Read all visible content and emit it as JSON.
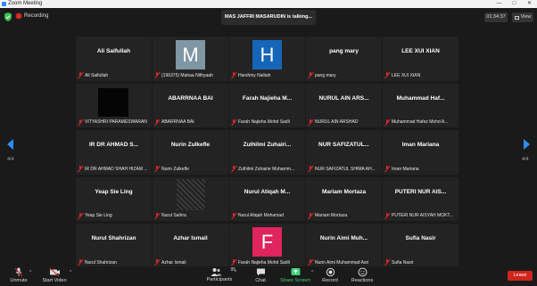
{
  "window": {
    "title": "Zoom Meeting"
  },
  "top": {
    "recording_label": "Recording",
    "talking_banner": "MAS JAFFRI MASARUDIN is talking...",
    "timer": "01:34:37",
    "view_label": "View"
  },
  "paging": {
    "left": "4/4",
    "right": "4/4"
  },
  "tiles": [
    {
      "big": "Ali Saifullah",
      "label": "Ali Saifullah"
    },
    {
      "avatar_letter": "M",
      "avatar_color": "#7f96a3",
      "label": "(196375) Mahaa Nithyaah"
    },
    {
      "avatar_letter": "H",
      "avatar_color": "#1565b8",
      "label": "Harshiny Naliiah"
    },
    {
      "big": "pang mary",
      "label": "pang mary"
    },
    {
      "big": "LEE XUI XIAN",
      "label": "LEE XUI XIAN"
    },
    {
      "video": "black",
      "label": "VITYASHRI PARAMESWARAN"
    },
    {
      "big": "ABARRNAA BAI",
      "label": "ABARRNAA BAI"
    },
    {
      "big": "Farah Najieha M...",
      "label": "Farah Najieha Mohd Sadli"
    },
    {
      "big": "NURUL AIN ARS...",
      "label": "NURUL AIN ARSHAD"
    },
    {
      "big": "Muhammad Haf...",
      "label": "Muhammad Hafez Mohd A..."
    },
    {
      "big": "IR DR AHMAD S...",
      "label": "IR DR AHMAD SHAH HIZAM ..."
    },
    {
      "big": "Nurin Zulkefle",
      "label": "Nurin Zulkefle"
    },
    {
      "big": "Zulhilmi Zuhairi...",
      "label": "Zulhilmi Zuhairie Muhamm..."
    },
    {
      "big": "NUR SAFIZATUL...",
      "label": "NUR SAFIZATUL SHIMA AH..."
    },
    {
      "big": "Iman Mariana",
      "label": "Iman Mariana"
    },
    {
      "big": "Yeap Sie Ling",
      "label": "Yeap Sie Ling"
    },
    {
      "video": "noise",
      "label": "Nurul Sahira"
    },
    {
      "big": "Nurul Atiqah M...",
      "label": "Nurul Atiqah Mohamad"
    },
    {
      "big": "Mariam Mortaza",
      "label": "Mariam Mortaza"
    },
    {
      "big": "PUTERI NUR AIS...",
      "label": "PUTERI NUR AISYAH MOKT..."
    },
    {
      "big": "Nurul Shahrizan",
      "label": "Nurul Shahrizan"
    },
    {
      "big": "Azhar Ismail",
      "label": "Azhar Ismail"
    },
    {
      "avatar_letter": "F",
      "avatar_color": "#e0245e",
      "label": "Farah Najieha Mohd Sadli"
    },
    {
      "big": "Nurin Aimi Muh...",
      "label": "Nurin Aimi Muhammad Asri"
    },
    {
      "big": "Sufia Nasir",
      "label": "Sufia Nasir"
    }
  ],
  "toolbar": {
    "unmute": "Unmute",
    "start_video": "Start Video",
    "participants": "Participants",
    "participant_count": "95",
    "chat": "Chat",
    "share_screen": "Share Screen",
    "record": "Record",
    "reactions": "Reactions",
    "leave": "Leave"
  },
  "colors": {
    "accent": "#2d8cff",
    "leave": "#d2241e",
    "share": "#3fd27a",
    "muted": "#e02828"
  }
}
